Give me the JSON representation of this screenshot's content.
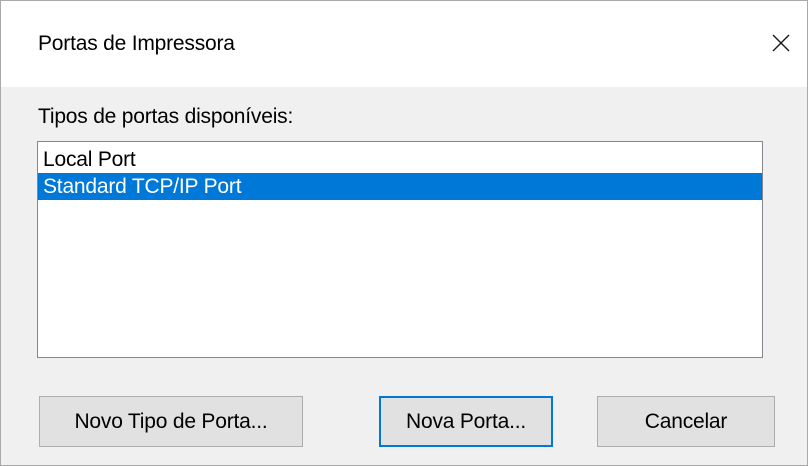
{
  "window": {
    "title": "Portas de Impressora",
    "close_icon": "close-icon"
  },
  "port_list": {
    "label": "Tipos de portas disponíveis:",
    "items": [
      {
        "label": "Local Port",
        "selected": false
      },
      {
        "label": "Standard TCP/IP Port",
        "selected": true
      }
    ],
    "selection_color": "#0078d7"
  },
  "buttons": {
    "new_port_type": "Novo Tipo de Porta...",
    "new_port": "Nova Porta...",
    "cancel": "Cancelar"
  }
}
